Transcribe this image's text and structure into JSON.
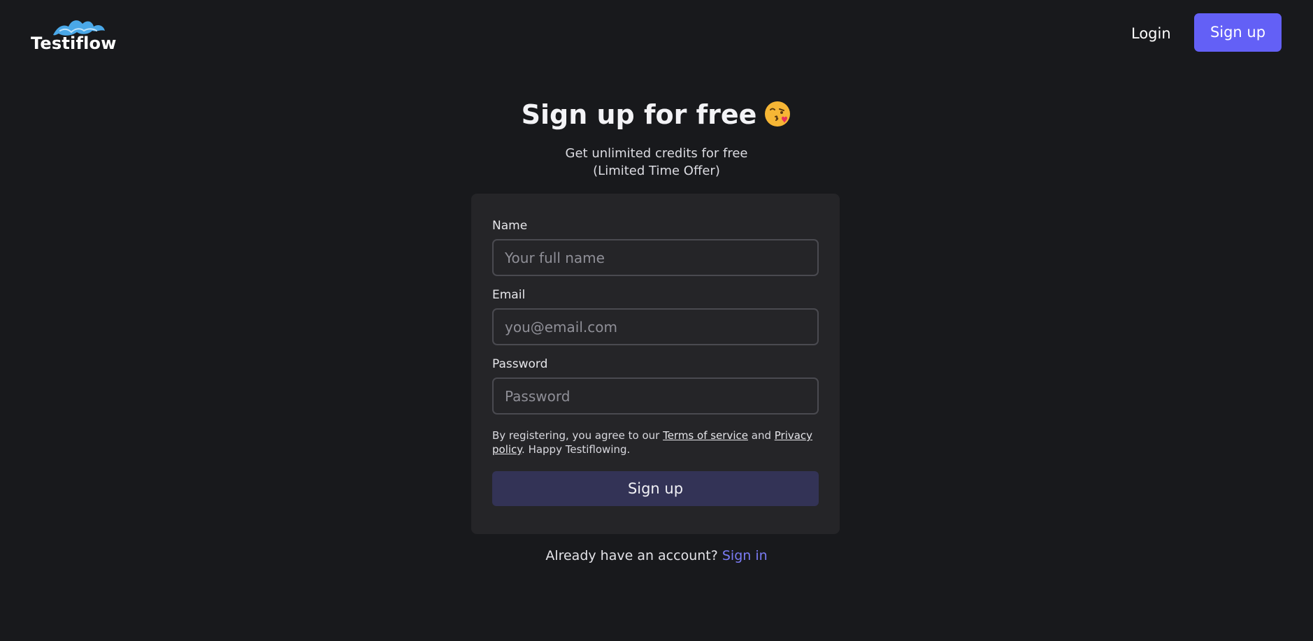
{
  "brand": {
    "name": "Testiflow",
    "logo_icon": "wave-logo-icon",
    "accent_color": "#6360f6"
  },
  "nav": {
    "login_label": "Login",
    "signup_label": "Sign up"
  },
  "hero": {
    "title": "Sign up for free",
    "emoji_icon": "face-blowing-kiss-emoji",
    "subtitle_line1": "Get unlimited credits for free",
    "subtitle_line2": "(Limited Time Offer)"
  },
  "form": {
    "name": {
      "label": "Name",
      "placeholder": "Your full name",
      "value": ""
    },
    "email": {
      "label": "Email",
      "placeholder": "you@email.com",
      "value": ""
    },
    "password": {
      "label": "Password",
      "placeholder": "Password",
      "value": ""
    },
    "terms": {
      "prefix": "By registering, you agree to our ",
      "terms_link": "Terms of service",
      "middle": " and ",
      "privacy_link": "Privacy policy",
      "suffix": ". Happy Testiflowing."
    },
    "submit_label": "Sign up"
  },
  "footer": {
    "prompt": "Already have an account? ",
    "signin_link": "Sign in"
  }
}
